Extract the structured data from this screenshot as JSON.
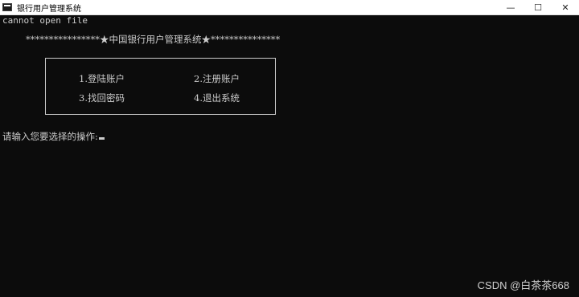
{
  "window": {
    "title": "银行用户管理系统",
    "icon": "console-app-icon",
    "controls": {
      "minimize": "—",
      "maximize": "☐",
      "close": "✕"
    }
  },
  "console": {
    "error_line": "cannot open file",
    "banner": "****************★中国银行用户管理系统★***************",
    "menu": {
      "item1": "1.登陆账户",
      "item2": "2.注册账户",
      "item3": "3.找回密码",
      "item4": "4.退出系统"
    },
    "prompt": "请输入您要选择的操作:"
  },
  "watermark": "CSDN @白茶茶668",
  "colors": {
    "console_background": "#0c0c0c",
    "console_text": "#cccccc",
    "titlebar_background": "#ffffff"
  }
}
